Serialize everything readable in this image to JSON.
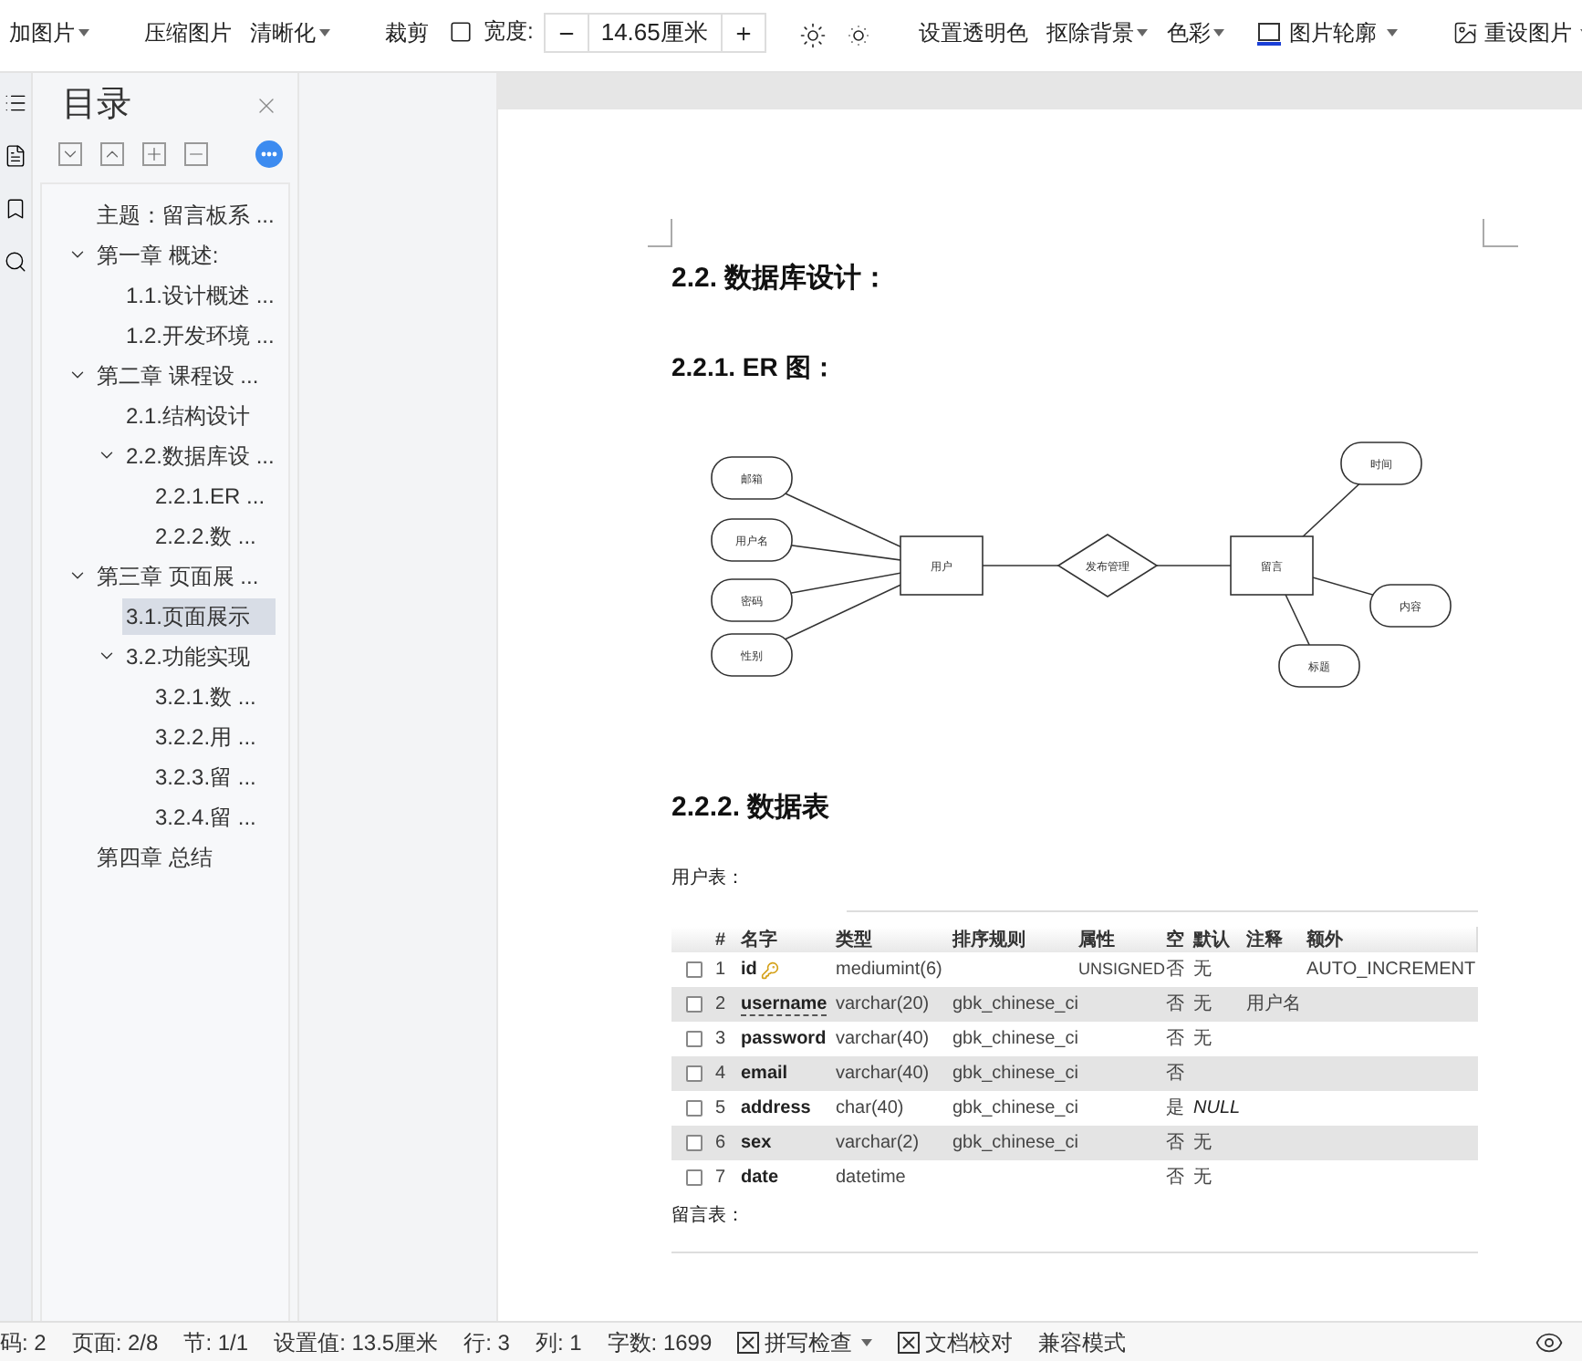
{
  "toolbar": {
    "items": [
      {
        "kind": "button",
        "label": "加图片",
        "dropdown": true
      },
      {
        "kind": "sep"
      },
      {
        "kind": "button",
        "label": "压缩图片",
        "dropdown": false
      },
      {
        "kind": "button",
        "label": "清晰化",
        "dropdown": true
      },
      {
        "kind": "sep"
      },
      {
        "kind": "button",
        "label": "裁剪",
        "dropdown": false
      },
      {
        "kind": "field",
        "label": "宽度:",
        "value": "14.65厘米"
      },
      {
        "kind": "brightness"
      },
      {
        "kind": "sep"
      },
      {
        "kind": "button",
        "label": "设置透明色",
        "dropdown": false
      },
      {
        "kind": "button",
        "label": "抠除背景",
        "dropdown": true
      },
      {
        "kind": "button",
        "label": "色彩",
        "dropdown": true
      },
      {
        "kind": "outline",
        "label": "图片轮廓",
        "dropdown": true
      },
      {
        "kind": "sep"
      },
      {
        "kind": "reset",
        "label": "重设图片",
        "dropdown": true
      },
      {
        "kind": "sep"
      }
    ]
  },
  "toc": {
    "title": "目录",
    "items": [
      {
        "label": "主题：留言板系 ...",
        "selected": false
      },
      {
        "label": "第一章  概述:",
        "selected": false,
        "expanded": true,
        "children": [
          {
            "label": "1.1.设计概述 ...",
            "selected": false
          },
          {
            "label": "1.2.开发环境 ...",
            "selected": false
          }
        ]
      },
      {
        "label": "第二章  课程设 ...",
        "selected": false,
        "expanded": true,
        "children": [
          {
            "label": "2.1.结构设计",
            "selected": false
          },
          {
            "label": "2.2.数据库设 ...",
            "selected": false,
            "expanded": true,
            "children": [
              {
                "label": "2.2.1.ER  ...",
                "selected": false
              },
              {
                "label": "2.2.2.数 ...",
                "selected": false
              }
            ]
          }
        ]
      },
      {
        "label": "第三章  页面展 ...",
        "selected": false,
        "expanded": true,
        "children": [
          {
            "label": "3.1.页面展示",
            "selected": true
          },
          {
            "label": "3.2.功能实现",
            "selected": false,
            "expanded": true,
            "children": [
              {
                "label": "3.2.1.数 ...",
                "selected": false
              },
              {
                "label": "3.2.2.用 ...",
                "selected": false
              },
              {
                "label": "3.2.3.留 ...",
                "selected": false
              },
              {
                "label": "3.2.4.留 ...",
                "selected": false
              }
            ]
          }
        ]
      },
      {
        "label": "第四章  总结",
        "selected": false
      }
    ]
  },
  "document": {
    "heading": "2.2. 数据库设计：",
    "subheading_er": "2.2.1. ER 图：",
    "er_diagram": {
      "nodes": [
        {
          "kind": "attribute",
          "label": "邮箱"
        },
        {
          "kind": "attribute",
          "label": "用户名"
        },
        {
          "kind": "attribute",
          "label": "密码"
        },
        {
          "kind": "attribute",
          "label": "性别"
        },
        {
          "kind": "entity",
          "label": "用户"
        },
        {
          "kind": "relation",
          "label": "发布管理"
        },
        {
          "kind": "entity",
          "label": "留言"
        },
        {
          "kind": "attribute",
          "label": "时间"
        },
        {
          "kind": "attribute",
          "label": "内容"
        },
        {
          "kind": "attribute",
          "label": "标题"
        }
      ]
    },
    "subheading_tables": "2.2.2. 数据表",
    "user_table_caption": "用户表：",
    "table": {
      "columns": [
        "#",
        "名字",
        "类型",
        "排序规则",
        "属性",
        "空",
        "默认",
        "注释",
        "额外"
      ],
      "rows": [
        {
          "checked": false,
          "cells": [
            "1",
            "id",
            "mediumint(6)",
            "",
            "UNSIGNED",
            "否",
            "无",
            "",
            "AUTO_INCREMENT"
          ],
          "primary_key": true,
          "default_italic": false
        },
        {
          "checked": false,
          "cells": [
            "2",
            "username",
            "varchar(20)",
            "gbk_chinese_ci",
            "",
            "否",
            "无",
            "用户名",
            ""
          ],
          "primary_key": false,
          "default_italic": false
        },
        {
          "checked": false,
          "cells": [
            "3",
            "password",
            "varchar(40)",
            "gbk_chinese_ci",
            "",
            "否",
            "无",
            "",
            ""
          ],
          "primary_key": false,
          "default_italic": false
        },
        {
          "checked": false,
          "cells": [
            "4",
            "email",
            "varchar(40)",
            "gbk_chinese_ci",
            "",
            "否",
            "",
            "",
            ""
          ],
          "primary_key": false
        },
        {
          "checked": false,
          "cells": [
            "5",
            "address",
            "char(40)",
            "gbk_chinese_ci",
            "",
            "是",
            "NULL",
            "",
            ""
          ],
          "primary_key": false,
          "default_italic": true
        },
        {
          "checked": false,
          "cells": [
            "6",
            "sex",
            "varchar(2)",
            "gbk_chinese_ci",
            "",
            "否",
            "无",
            "",
            ""
          ],
          "primary_key": false,
          "default_italic": false
        },
        {
          "checked": false,
          "cells": [
            "7",
            "date",
            "datetime",
            "",
            "",
            "否",
            "无",
            "",
            ""
          ],
          "primary_key": false,
          "default_italic": false
        }
      ]
    },
    "message_table_caption": "留言表："
  },
  "status_bar": {
    "items": [
      {
        "kind": "text",
        "label": "码: 2"
      },
      {
        "kind": "text",
        "label": "页面: 2/8"
      },
      {
        "kind": "text",
        "label": "节: 1/1"
      },
      {
        "kind": "text",
        "label": "设置值: 13.5厘米"
      },
      {
        "kind": "text",
        "label": "行: 3"
      },
      {
        "kind": "text",
        "label": "列: 1"
      },
      {
        "kind": "text",
        "label": "字数: 1699"
      },
      {
        "kind": "check",
        "label": "拼写检查",
        "dropdown": true
      },
      {
        "kind": "check",
        "label": "文档校对",
        "dropdown": false
      },
      {
        "kind": "text",
        "label": "兼容模式"
      }
    ]
  }
}
